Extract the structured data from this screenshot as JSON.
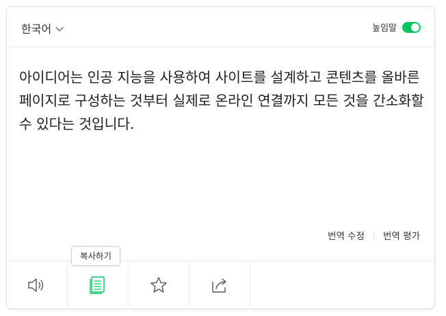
{
  "header": {
    "language_label": "한국어",
    "honorific_label": "높임말",
    "honorific_enabled": true,
    "accent_color": "#03c75a"
  },
  "result": {
    "text": "아이디어는 인공 지능을 사용하여 사이트를 설계하고 콘텐츠를 올바른 페이지로 구성하는 것부터 실제로 온라인 연결까지 모든 것을 간소화할 수 있다는 것입니다."
  },
  "feedback": {
    "edit_label": "번역 수정",
    "rate_label": "번역 평가"
  },
  "tooltip": {
    "text": "복사하기"
  },
  "toolbar": {
    "buttons": [
      {
        "icon": "speaker-icon"
      },
      {
        "icon": "copy-icon"
      },
      {
        "icon": "star-icon"
      },
      {
        "icon": "share-icon"
      }
    ]
  }
}
